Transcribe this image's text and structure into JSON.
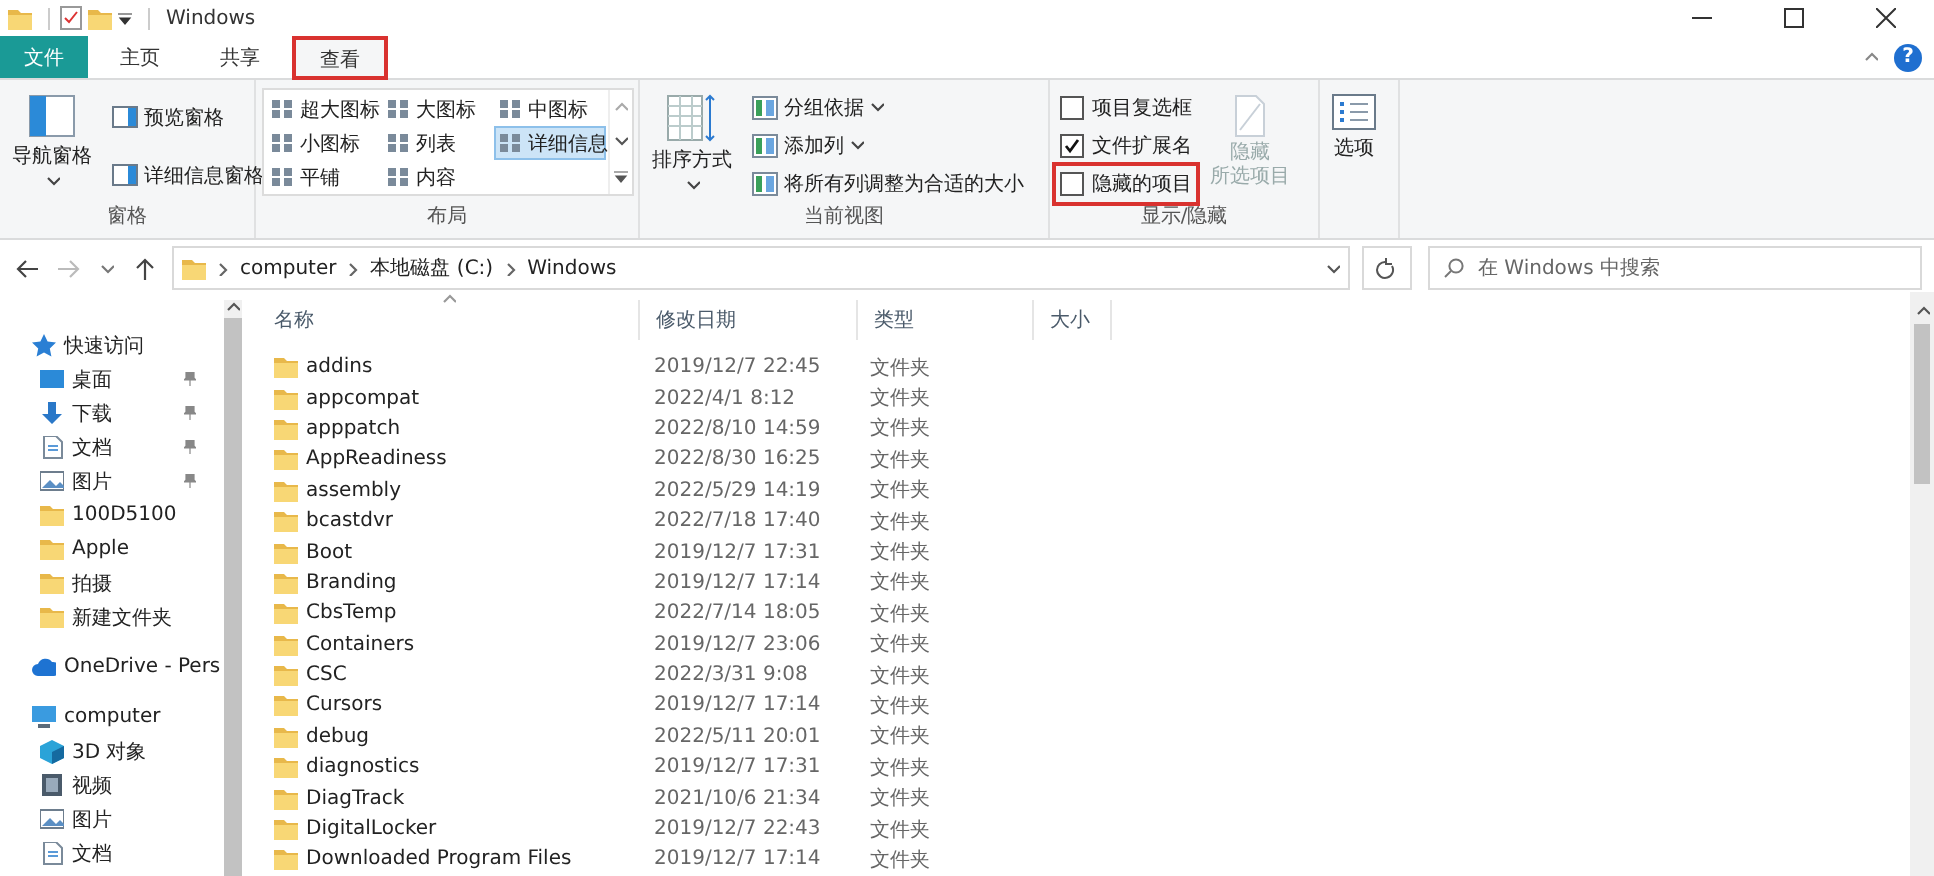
{
  "window": {
    "title": "Windows"
  },
  "ribbon_tabs": [
    {
      "label": "文件",
      "kind": "file",
      "selected": false,
      "highlighted": false
    },
    {
      "label": "主页",
      "kind": "tab",
      "selected": false,
      "highlighted": false
    },
    {
      "label": "共享",
      "kind": "tab",
      "selected": false,
      "highlighted": false
    },
    {
      "label": "查看",
      "kind": "tab",
      "selected": true,
      "highlighted": true
    }
  ],
  "help": "?",
  "ribbon": {
    "panes": {
      "label": "窗格",
      "nav_pane": "导航窗格",
      "items": [
        "预览窗格",
        "详细信息窗格"
      ]
    },
    "layout": {
      "label": "布局",
      "options": [
        {
          "label": "超大图标",
          "selected": false
        },
        {
          "label": "大图标",
          "selected": false
        },
        {
          "label": "中图标",
          "selected": false
        },
        {
          "label": "小图标",
          "selected": false
        },
        {
          "label": "列表",
          "selected": false
        },
        {
          "label": "详细信息",
          "selected": true
        },
        {
          "label": "平铺",
          "selected": false
        },
        {
          "label": "内容",
          "selected": false
        }
      ]
    },
    "current_view": {
      "label": "当前视图",
      "sort": "排序方式",
      "items": [
        {
          "label": "分组依据",
          "dropdown": true
        },
        {
          "label": "添加列",
          "dropdown": true
        },
        {
          "label": "将所有列调整为合适的大小",
          "dropdown": false
        }
      ]
    },
    "show_hide": {
      "label": "显示/隐藏",
      "checkboxes": [
        {
          "label": "项目复选框",
          "checked": false,
          "highlighted": false
        },
        {
          "label": "文件扩展名",
          "checked": true,
          "highlighted": false
        },
        {
          "label": "隐藏的项目",
          "checked": false,
          "highlighted": true
        }
      ],
      "hide_selected": {
        "label_1": "隐藏",
        "label_2": "所选项目",
        "disabled": true
      }
    },
    "options": {
      "label": "选项"
    }
  },
  "address": {
    "back_disabled": false,
    "forward_disabled": true,
    "path": [
      "computer",
      "本地磁盘 (C:)",
      "Windows"
    ],
    "search_placeholder": "在 Windows 中搜索"
  },
  "sidebar": {
    "items": [
      {
        "label": "快速访问",
        "kind": "star",
        "children": [
          {
            "label": "桌面",
            "kind": "desktop",
            "pinned": true
          },
          {
            "label": "下载",
            "kind": "download",
            "pinned": true
          },
          {
            "label": "文档",
            "kind": "document",
            "pinned": true
          },
          {
            "label": "图片",
            "kind": "picture",
            "pinned": true
          },
          {
            "label": "100D5100",
            "kind": "folder",
            "pinned": false
          },
          {
            "label": "Apple",
            "kind": "folder",
            "pinned": false
          },
          {
            "label": "拍摄",
            "kind": "folder",
            "pinned": false
          },
          {
            "label": "新建文件夹",
            "kind": "folder",
            "pinned": false
          }
        ]
      },
      {
        "label": "OneDrive - Pers",
        "kind": "cloud"
      },
      {
        "label": "computer",
        "kind": "pc",
        "children": [
          {
            "label": "3D 对象",
            "kind": "cube"
          },
          {
            "label": "视频",
            "kind": "video"
          },
          {
            "label": "图片",
            "kind": "picture"
          },
          {
            "label": "文档",
            "kind": "document"
          }
        ]
      }
    ]
  },
  "file_list": {
    "columns": [
      {
        "label": "名称",
        "sorted": true
      },
      {
        "label": "修改日期",
        "sorted": false
      },
      {
        "label": "类型",
        "sorted": false
      },
      {
        "label": "大小",
        "sorted": false
      }
    ],
    "rows": [
      {
        "name": "addins",
        "modified": "2019/12/7 22:45",
        "type": "文件夹"
      },
      {
        "name": "appcompat",
        "modified": "2022/4/1 8:12",
        "type": "文件夹"
      },
      {
        "name": "apppatch",
        "modified": "2022/8/10 14:59",
        "type": "文件夹"
      },
      {
        "name": "AppReadiness",
        "modified": "2022/8/30 16:25",
        "type": "文件夹"
      },
      {
        "name": "assembly",
        "modified": "2022/5/29 14:19",
        "type": "文件夹"
      },
      {
        "name": "bcastdvr",
        "modified": "2022/7/18 17:40",
        "type": "文件夹"
      },
      {
        "name": "Boot",
        "modified": "2019/12/7 17:31",
        "type": "文件夹"
      },
      {
        "name": "Branding",
        "modified": "2019/12/7 17:14",
        "type": "文件夹"
      },
      {
        "name": "CbsTemp",
        "modified": "2022/7/14 18:05",
        "type": "文件夹"
      },
      {
        "name": "Containers",
        "modified": "2019/12/7 23:06",
        "type": "文件夹"
      },
      {
        "name": "CSC",
        "modified": "2022/3/31 9:08",
        "type": "文件夹"
      },
      {
        "name": "Cursors",
        "modified": "2019/12/7 17:14",
        "type": "文件夹"
      },
      {
        "name": "debug",
        "modified": "2022/5/11 20:01",
        "type": "文件夹"
      },
      {
        "name": "diagnostics",
        "modified": "2019/12/7 17:31",
        "type": "文件夹"
      },
      {
        "name": "DiagTrack",
        "modified": "2021/10/6 21:34",
        "type": "文件夹"
      },
      {
        "name": "DigitalLocker",
        "modified": "2019/12/7 22:43",
        "type": "文件夹"
      },
      {
        "name": "Downloaded Program Files",
        "modified": "2019/12/7 17:14",
        "type": "文件夹"
      }
    ]
  }
}
